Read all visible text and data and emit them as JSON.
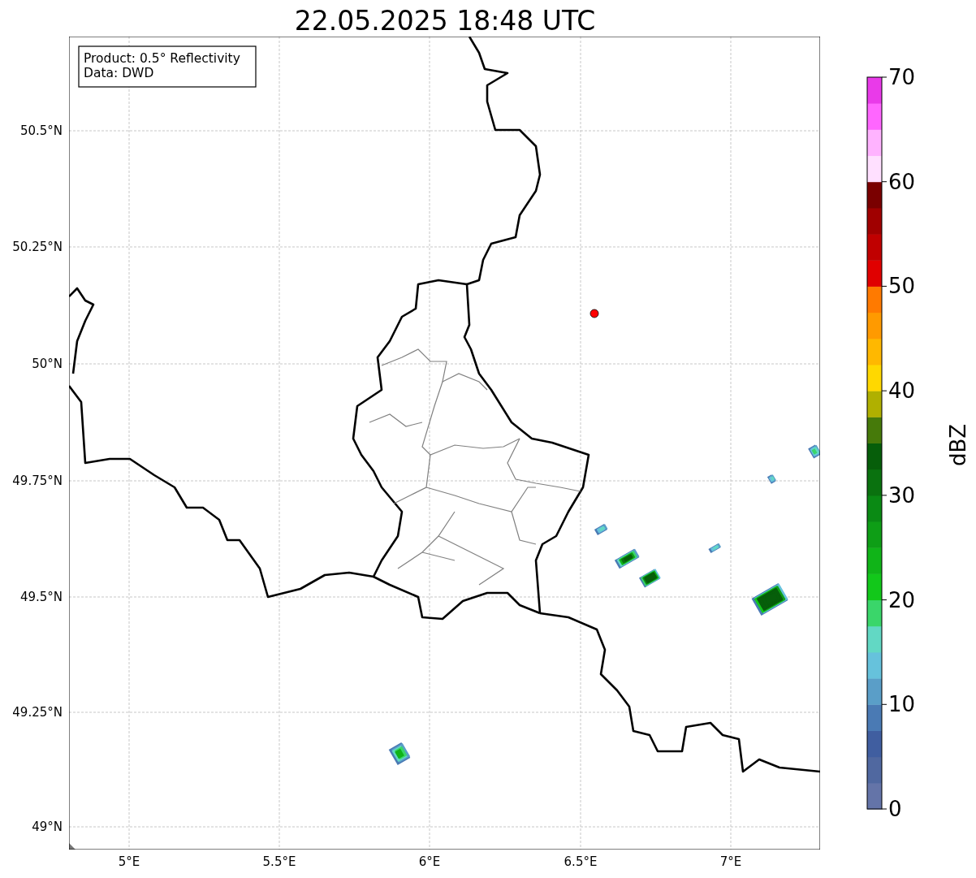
{
  "title": "22.05.2025 18:48 UTC",
  "info_box": {
    "lines": [
      "Product: 0.5° Reflectivity",
      "Data: DWD"
    ]
  },
  "map": {
    "lat_ticks": [
      "50.5°N",
      "50.25°N",
      "50°N",
      "49.75°N",
      "49.5°N",
      "49.25°N",
      "49°N"
    ],
    "lon_ticks": [
      "5°E",
      "5.5°E",
      "6°E",
      "6.5°E",
      "7°E"
    ]
  },
  "colorbar": {
    "label": "dBZ",
    "ticks": [
      "70",
      "60",
      "50",
      "40",
      "30",
      "20",
      "10",
      "0"
    ],
    "segments": [
      {
        "color": "#6474a8"
      },
      {
        "color": "#5068a0"
      },
      {
        "color": "#405ea0"
      },
      {
        "color": "#4a7ab4"
      },
      {
        "color": "#5a9ec8"
      },
      {
        "color": "#66c2dc"
      },
      {
        "color": "#62d8c4"
      },
      {
        "color": "#3ad66a"
      },
      {
        "color": "#12c81a"
      },
      {
        "color": "#10b418"
      },
      {
        "color": "#0e9e16"
      },
      {
        "color": "#0a8a14"
      },
      {
        "color": "#0a720f"
      },
      {
        "color": "#065e0a"
      },
      {
        "color": "#467a0a"
      },
      {
        "color": "#b0b000"
      },
      {
        "color": "#ffd800"
      },
      {
        "color": "#ffb800"
      },
      {
        "color": "#ff9a00"
      },
      {
        "color": "#ff7a00"
      },
      {
        "color": "#e00000"
      },
      {
        "color": "#c00000"
      },
      {
        "color": "#a00000"
      },
      {
        "color": "#7a0000"
      },
      {
        "color": "#ffe0ff"
      },
      {
        "color": "#ffb3ff"
      },
      {
        "color": "#ff66ff"
      },
      {
        "color": "#e93ae9"
      }
    ]
  }
}
